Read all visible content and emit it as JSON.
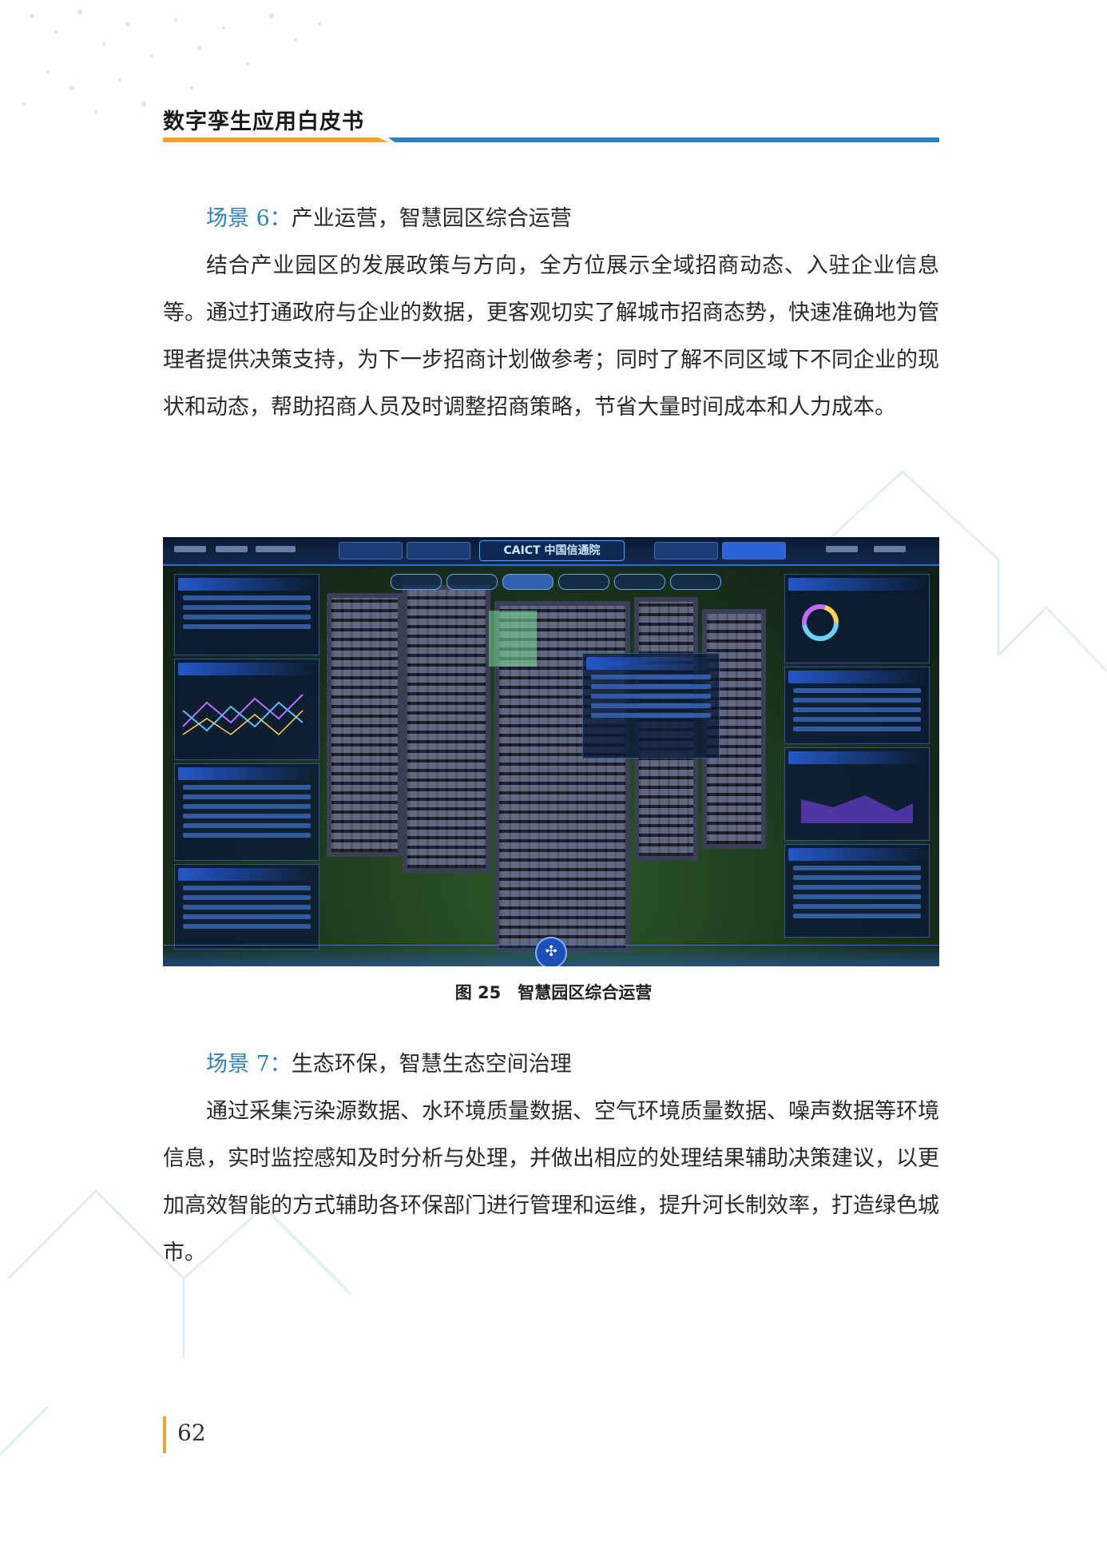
{
  "header": {
    "title": "数字孪生应用白皮书"
  },
  "sections": [
    {
      "scene_label": "场景 6：",
      "scene_title": "产业运营，智慧园区综合运营",
      "paragraph": "结合产业园区的发展政策与方向，全方位展示全域招商动态、入驻企业信息等。通过打通政府与企业的数据，更客观切实了解城市招商态势，快速准确地为管理者提供决策支持，为下一步招商计划做参考；同时了解不同区域下不同企业的现状和动态，帮助招商人员及时调整招商策略，节省大量时间成本和人力成本。"
    },
    {
      "scene_label": "场景 7：",
      "scene_title": "生态环保，智慧生态空间治理",
      "paragraph": "通过采集污染源数据、水环境质量数据、空气环境质量数据、噪声数据等环境信息，实时监控感知及时分析与处理，并做出相应的处理结果辅助决策建议，以更加高效智能的方式辅助各环保部门进行管理和运维，提升河长制效率，打造绿色城市。"
    }
  ],
  "figure": {
    "caption": "图 25　智慧园区综合运营",
    "logo_text": "CAICT 中国信通院"
  },
  "footer": {
    "page_number": "62"
  },
  "colors": {
    "scene_label": "#2f82b8",
    "rule_orange": "#f0a12a",
    "rule_blue": "#2f82b8"
  }
}
